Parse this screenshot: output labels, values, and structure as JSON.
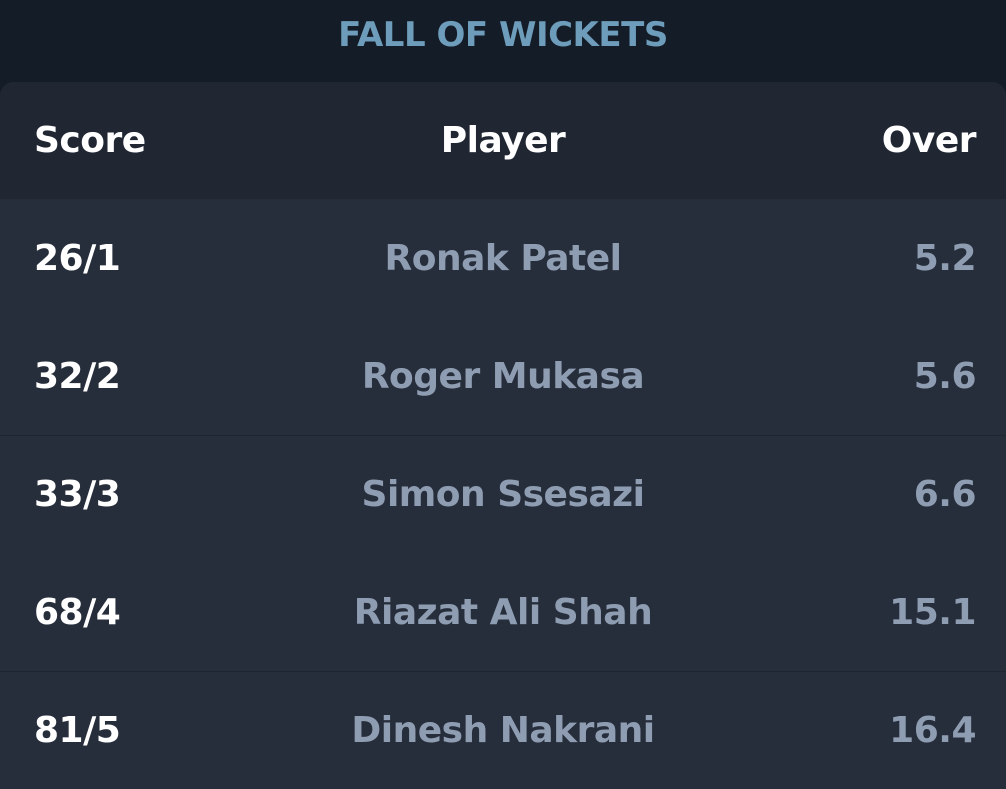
{
  "title": "FALL OF WICKETS",
  "headers": {
    "score": "Score",
    "player": "Player",
    "over": "Over"
  },
  "rows": [
    {
      "score": "26/1",
      "player": "Ronak Patel",
      "over": "5.2"
    },
    {
      "score": "32/2",
      "player": "Roger Mukasa",
      "over": "5.6"
    },
    {
      "score": "33/3",
      "player": "Simon Ssesazi",
      "over": "6.6"
    },
    {
      "score": "68/4",
      "player": "Riazat Ali Shah",
      "over": "15.1"
    },
    {
      "score": "81/5",
      "player": "Dinesh Nakrani",
      "over": "16.4"
    }
  ],
  "colors": {
    "background": "#141c28",
    "title": "#6e9cbb",
    "panel": "#272e3b",
    "header_row": "#202733",
    "score_text": "#ffffff",
    "secondary_text": "#8f9db3"
  }
}
